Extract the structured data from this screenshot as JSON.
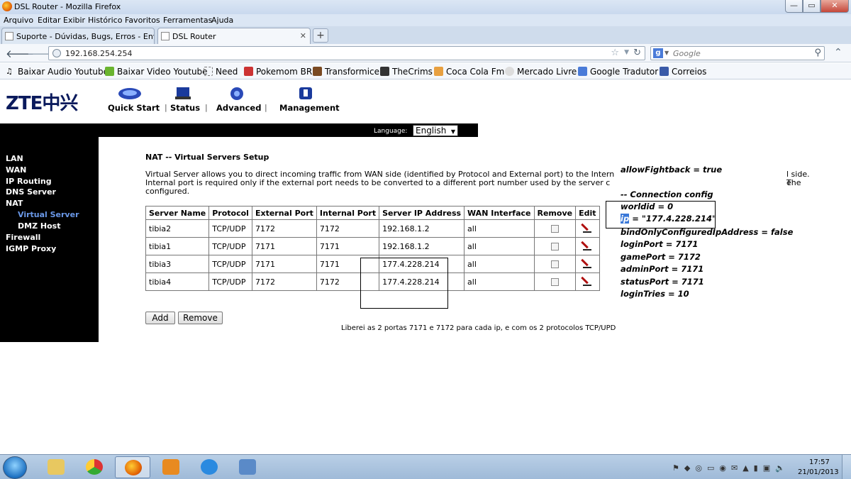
{
  "window": {
    "title": "DSL Router - Mozilla Firefox"
  },
  "menu": [
    "Arquivo",
    "Editar",
    "Exibir",
    "Histórico",
    "Favoritos",
    "Ferramentas",
    "Ajuda"
  ],
  "tabs": [
    {
      "label": "Suporte - Dúvidas, Bugs, Erros - Envia...",
      "active": false
    },
    {
      "label": "DSL Router",
      "active": true
    }
  ],
  "navbar": {
    "url": "192.168.254.254",
    "search_placeholder": "Google"
  },
  "bookmarks": [
    "Baixar Audio Youtube",
    "Baixar Video Youtube",
    "Need",
    "Pokemom BR",
    "Transformice",
    "TheCrims",
    "Coca Cola Fm",
    "Mercado Livre",
    "Google Tradutor",
    "Correios"
  ],
  "router": {
    "logo": "ZTE中兴",
    "topnav": [
      "Quick Start",
      "Status",
      "Advanced",
      "Management"
    ],
    "language_label": "Language:",
    "language_value": "English",
    "sidebar": [
      "LAN",
      "WAN",
      "IP Routing",
      "DNS Server",
      "NAT",
      "Virtual Server",
      "DMZ Host",
      "Firewall",
      "IGMP Proxy"
    ],
    "page_title": "NAT -- Virtual Servers Setup",
    "description": "Virtual Server allows you to direct incoming traffic from WAN side (identified by Protocol and External port) to the Intern",
    "description_end": "l side. The",
    "description_line2": "Internal port is required only if the external port needs to be converted to a different port number used by the server c",
    "description_line2_end": "e",
    "description_line3": "configured.",
    "table": {
      "headers": [
        "Server Name",
        "Protocol",
        "External Port",
        "Internal Port",
        "Server IP Address",
        "WAN Interface",
        "Remove",
        "Edit"
      ],
      "rows": [
        {
          "name": "tibia2",
          "protocol": "TCP/UDP",
          "ext": "7172",
          "int": "7172",
          "ip": "192.168.1.2",
          "wan": "all"
        },
        {
          "name": "tibia1",
          "protocol": "TCP/UDP",
          "ext": "7171",
          "int": "7171",
          "ip": "192.168.1.2",
          "wan": "all"
        },
        {
          "name": "tibia3",
          "protocol": "TCP/UDP",
          "ext": "7171",
          "int": "7171",
          "ip": "177.4.228.214",
          "wan": "all"
        },
        {
          "name": "tibia4",
          "protocol": "TCP/UDP",
          "ext": "7172",
          "int": "7172",
          "ip": "177.4.228.214",
          "wan": "all"
        }
      ]
    },
    "buttons": {
      "add": "Add",
      "remove": "Remove"
    },
    "footnote": "Liberei as 2 portas 7171 e 7172 para cada ip, e com os 2 protocolos TCP/UPD"
  },
  "config_notes": {
    "allowFightback": "allowFightback = true",
    "section": "-- Connection config",
    "worldid": "worldid = 0",
    "ip_key": "ip",
    "ip_value": " = \"177.4.228.214\"",
    "bindOnly": "bindOnlyConfiguredIpAddress = false",
    "loginPort": "loginPort = 7171",
    "gamePort": "gamePort = 7172",
    "adminPort": "adminPort = 7171",
    "statusPort": "statusPort = 7171",
    "loginTries": "loginTries = 10"
  },
  "taskbar": {
    "time": "17:57",
    "date": "21/01/2013"
  }
}
